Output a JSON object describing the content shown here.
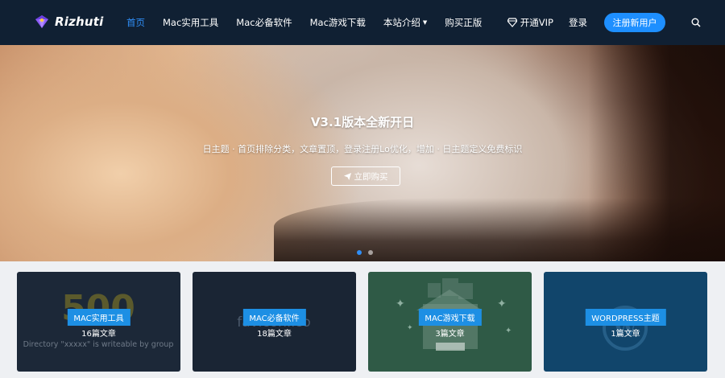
{
  "colors": {
    "header_bg": "#102033",
    "accent": "#2f8ef6",
    "register_bg": "#1e8fff",
    "badge_bg": "#1d8fe4"
  },
  "header": {
    "logo_icon": "gem-icon",
    "logo_text": "Rizhuti",
    "nav": [
      {
        "label": "首页",
        "active": true
      },
      {
        "label": "Mac实用工具"
      },
      {
        "label": "Mac必备软件"
      },
      {
        "label": "Mac游戏下载"
      },
      {
        "label": "本站介绍",
        "has_dropdown": true
      },
      {
        "label": "购买正版"
      }
    ],
    "vip_icon": "diamond-icon",
    "vip_label": "开通VIP",
    "login_label": "登录",
    "register_label": "注册新用户",
    "search_icon": "search-icon"
  },
  "hero": {
    "title": "V3.1版本全新开日",
    "subtitle": "日主题 · 首页排除分类，文章置顶，登录注册Lo优化，增加 · 日主题定义免费标识",
    "button_icon": "send-icon",
    "button_label": "立即购买",
    "slides": 2,
    "active_slide": 0
  },
  "cards": [
    {
      "label": "MAC实用工具",
      "count": "16篇文章",
      "bg_text_big": "500",
      "bg_text_small": "Directory \"xxxxx\" is writeable by group"
    },
    {
      "label": "MAC必备软件",
      "count": "18篇文章",
      "bg_text_big": "favicon.ico"
    },
    {
      "label": "MAC游戏下载",
      "count": "3篇文章"
    },
    {
      "label": "WORDPRESS主题",
      "count": "1篇文章"
    }
  ]
}
